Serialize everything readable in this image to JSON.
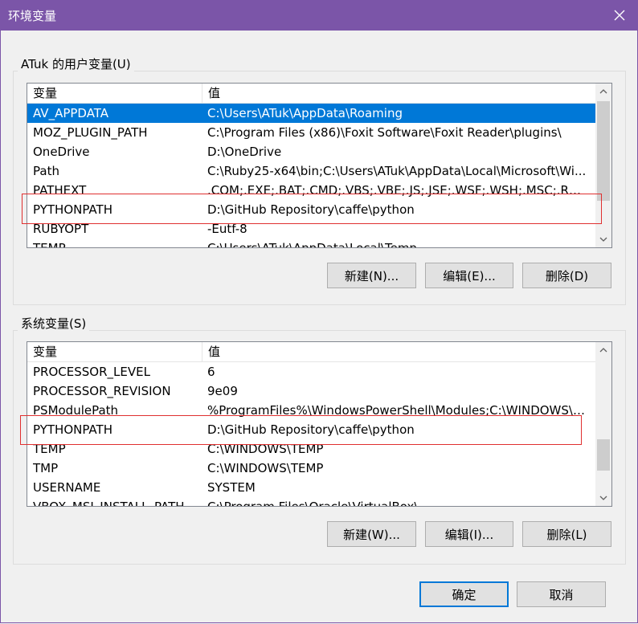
{
  "window": {
    "title": "环境变量",
    "close_glyph": "✕"
  },
  "user_vars": {
    "group_label": "ATuk 的用户变量(U)",
    "col_name": "变量",
    "col_value": "值",
    "rows": [
      {
        "name": "AV_APPDATA",
        "value": "C:\\Users\\ATuk\\AppData\\Roaming",
        "selected": true
      },
      {
        "name": "MOZ_PLUGIN_PATH",
        "value": "C:\\Program Files (x86)\\Foxit Software\\Foxit Reader\\plugins\\"
      },
      {
        "name": "OneDrive",
        "value": "D:\\OneDrive"
      },
      {
        "name": "Path",
        "value": "C:\\Ruby25-x64\\bin;C:\\Users\\ATuk\\AppData\\Local\\Microsoft\\Wi..."
      },
      {
        "name": "PATHEXT",
        "value": ".COM;.EXE;.BAT;.CMD;.VBS;.VBE;.JS;.JSE;.WSF;.WSH;.MSC;.RB;.RB..."
      },
      {
        "name": "PYTHONPATH",
        "value": "D:\\GitHub Repository\\caffe\\python"
      },
      {
        "name": "RUBYOPT",
        "value": "-Eutf-8"
      },
      {
        "name": "TEMP",
        "value": "C:\\Users\\ATuk\\AppData\\Local\\Temp"
      }
    ],
    "new_label": "新建(N)...",
    "edit_label": "编辑(E)...",
    "delete_label": "删除(D)"
  },
  "system_vars": {
    "group_label": "系统变量(S)",
    "col_name": "变量",
    "col_value": "值",
    "rows": [
      {
        "name": "PROCESSOR_LEVEL",
        "value": "6"
      },
      {
        "name": "PROCESSOR_REVISION",
        "value": "9e09"
      },
      {
        "name": "PSModulePath",
        "value": "%ProgramFiles%\\WindowsPowerShell\\Modules;C:\\WINDOWS\\s..."
      },
      {
        "name": "PYTHONPATH",
        "value": "D:\\GitHub Repository\\caffe\\python"
      },
      {
        "name": "TEMP",
        "value": "C:\\WINDOWS\\TEMP"
      },
      {
        "name": "TMP",
        "value": "C:\\WINDOWS\\TEMP"
      },
      {
        "name": "USERNAME",
        "value": "SYSTEM"
      },
      {
        "name": "VBOX_MSI_INSTALL_PATH",
        "value": "C:\\Program Files\\Oracle\\VirtualBox\\"
      }
    ],
    "new_label": "新建(W)...",
    "edit_label": "编辑(I)...",
    "delete_label": "删除(L)"
  },
  "footer": {
    "ok_label": "确定",
    "cancel_label": "取消"
  },
  "colors": {
    "titlebar": "#7b55a8",
    "selection": "#0078d7",
    "highlight_box": "#e03030"
  }
}
